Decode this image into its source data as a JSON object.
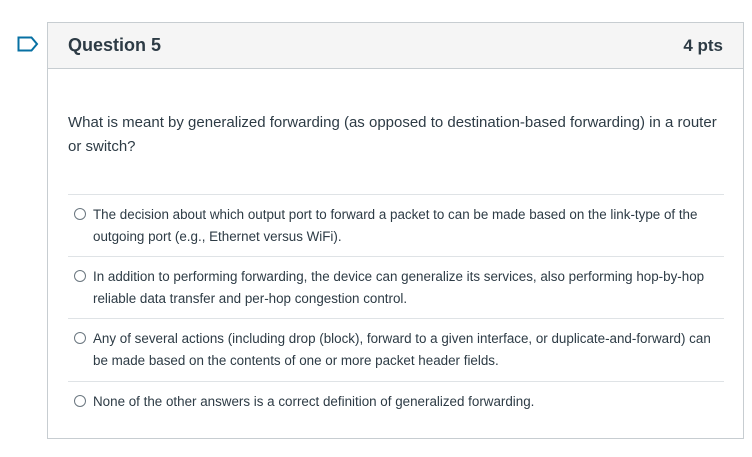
{
  "question": {
    "title": "Question 5",
    "points": "4 pts",
    "text": "What is meant by generalized forwarding (as opposed to destination-based forwarding) in a router or switch?",
    "flag_icon": "flag-outline-icon",
    "accent_color": "#0770a3"
  },
  "answers": [
    {
      "label": "The decision about which output port to forward a packet to can be made based on the link-type of the outgoing port (e.g., Ethernet versus WiFi).",
      "selected": false
    },
    {
      "label": "In addition to performing forwarding, the device can generalize its services, also performing hop-by-hop reliable data transfer and per-hop congestion control.",
      "selected": false
    },
    {
      "label": "Any of several actions (including drop (block), forward to a given interface, or duplicate-and-forward) can be made based on the contents of one or more packet header fields.",
      "selected": false
    },
    {
      "label": "None of the other answers is a correct definition of generalized forwarding.",
      "selected": false
    }
  ]
}
